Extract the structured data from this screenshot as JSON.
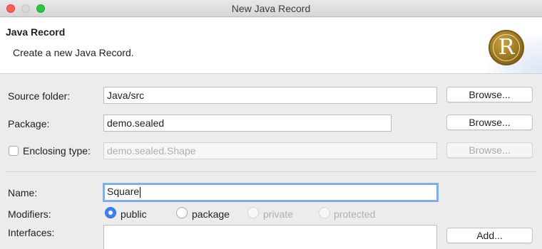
{
  "window": {
    "title": "New Java Record"
  },
  "header": {
    "title": "Java Record",
    "description": "Create a new Java Record.",
    "logo_letter": "R",
    "logo_colors": {
      "gold": "#9a7420",
      "highlight": "#f1df9e"
    }
  },
  "source_folder": {
    "label": "Source folder:",
    "value": "Java/src",
    "browse_label": "Browse..."
  },
  "package": {
    "label": "Package:",
    "value": "demo.sealed",
    "browse_label": "Browse..."
  },
  "enclosing_type": {
    "label": "Enclosing type:",
    "checked": false,
    "value": "demo.sealed.Shape",
    "browse_label": "Browse..."
  },
  "name": {
    "label": "Name:",
    "value": "Square"
  },
  "modifiers": {
    "label": "Modifiers:",
    "options": [
      {
        "label": "public",
        "selected": true,
        "enabled": true
      },
      {
        "label": "package",
        "selected": false,
        "enabled": true
      },
      {
        "label": "private",
        "selected": false,
        "enabled": false
      },
      {
        "label": "protected",
        "selected": false,
        "enabled": false
      }
    ]
  },
  "interfaces": {
    "label": "Interfaces:",
    "add_label": "Add..."
  },
  "colors": {
    "accent": "#3b82f6",
    "focus_ring": "#7faee8"
  }
}
